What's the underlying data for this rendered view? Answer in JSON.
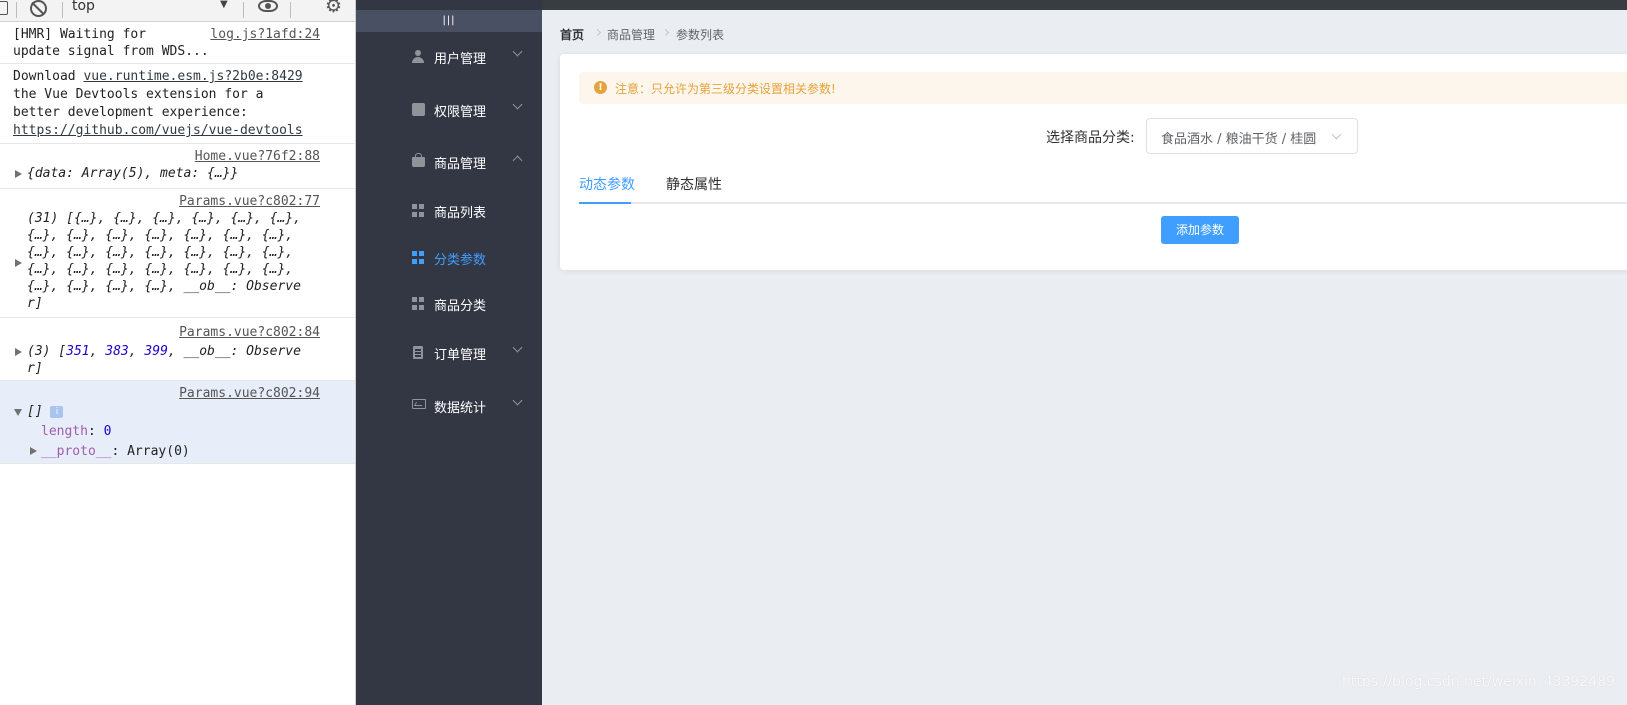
{
  "devtools": {
    "context": "top",
    "messages": {
      "hmr": {
        "line1": "[HMR] Waiting for",
        "line2": "update signal from WDS...",
        "source": "log.js?1afd:24"
      },
      "vue_devtools": {
        "line1_prefix": "Download ",
        "line1_link": "vue.runtime.esm.js?2b0e:8429",
        "line2": "the Vue Devtools extension for a",
        "line3": "better development experience:",
        "line4_link": "https://github.com/vuejs/vue-devtools"
      },
      "home": {
        "source": "Home.vue?76f2:88",
        "text": "{data: Array(5), meta: {…}}"
      },
      "params77": {
        "source": "Params.vue?c802:77",
        "lines": [
          "(31) [{…}, {…}, {…}, {…}, {…}, {…},",
          "{…}, {…}, {…}, {…}, {…}, {…}, {…},",
          "{…}, {…}, {…}, {…}, {…}, {…}, {…},",
          "{…}, {…}, {…}, {…}, {…}, {…}, {…},",
          "{…}, {…}, {…}, {…}, __ob__: Observe",
          "r]"
        ]
      },
      "params84": {
        "source": "Params.vue?c802:84",
        "prefix": "(3) [",
        "n1": "351",
        "n2": "383",
        "n3": "399",
        "suffix": ", __ob__: Observe",
        "line2": "r]"
      },
      "params94": {
        "source": "Params.vue?c802:94",
        "array": "[]",
        "badge": "i",
        "length_key": "length",
        "length_val": "0",
        "proto_key": "__proto__",
        "proto_val": ": Array(0)"
      }
    }
  },
  "sidebar": {
    "collapse": "|||",
    "items": [
      {
        "label": "用户管理",
        "icon": "user-icon"
      },
      {
        "label": "权限管理",
        "icon": "box-icon"
      },
      {
        "label": "商品管理",
        "icon": "bag-icon"
      },
      {
        "label": "商品列表",
        "icon": "grid-icon"
      },
      {
        "label": "分类参数",
        "icon": "grid-icon"
      },
      {
        "label": "商品分类",
        "icon": "grid-icon"
      },
      {
        "label": "订单管理",
        "icon": "clipboard-icon"
      },
      {
        "label": "数据统计",
        "icon": "chart-icon"
      }
    ]
  },
  "breadcrumb": [
    "首页",
    "商品管理",
    "参数列表"
  ],
  "alert": {
    "text": "注意：只允许为第三级分类设置相关参数!"
  },
  "category": {
    "label": "选择商品分类:",
    "value": "食品酒水 / 粮油干货 / 桂圆"
  },
  "tabs": [
    "动态参数",
    "静态属性"
  ],
  "add_button": "添加参数",
  "watermark": "https://blog.csdn.net/weixin_43392489",
  "colors": {
    "primary": "#409eff",
    "warning": "#e6a23c",
    "sidebar": "#333744",
    "page_bg": "#eaedf1"
  }
}
